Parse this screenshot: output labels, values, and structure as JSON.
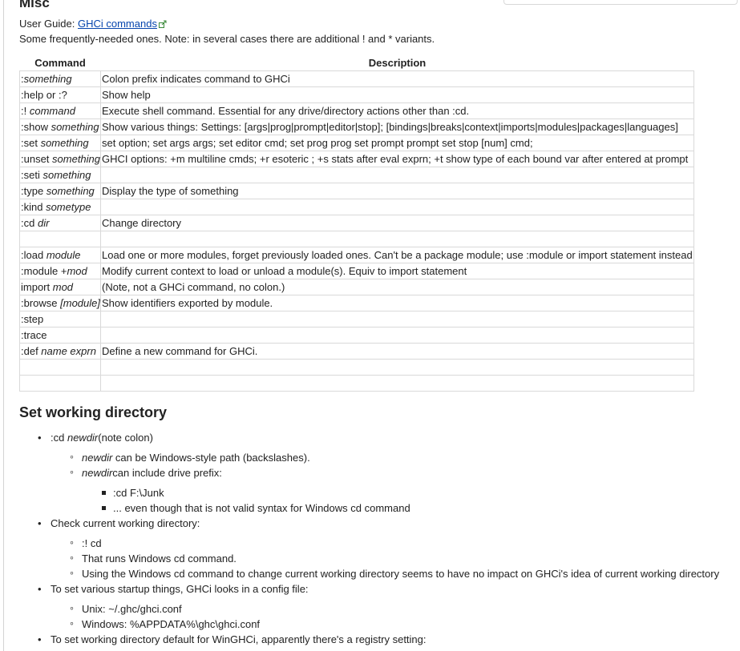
{
  "misc": {
    "heading": "Misc",
    "guide_label": "User Guide: ",
    "guide_link": "GHCi commands",
    "intro": "Some frequently-needed ones. Note: in several cases there are additional ! and * variants."
  },
  "table": {
    "headers": [
      "Command",
      "Description"
    ],
    "rows": [
      {
        "cmd": ":",
        "arg": "something",
        "desc": "Colon prefix indicates command to GHCi"
      },
      {
        "cmd": ":help or :?",
        "arg": "",
        "desc": "Show help"
      },
      {
        "cmd": ":! ",
        "arg": "command",
        "desc": "Execute shell command. Essential for any drive/directory actions other than :cd."
      },
      {
        "cmd": ":show ",
        "arg": "something",
        "desc": "Show various things: Settings: [args|prog|prompt|editor|stop]; [bindings|breaks|context|imports|modules|packages|languages]"
      },
      {
        "cmd": ":set ",
        "arg": "something",
        "desc": "set option; set args args; set editor cmd; set prog prog set prompt prompt set stop [num] cmd;"
      },
      {
        "cmd": ":unset ",
        "arg": "something",
        "desc": "GHCI options: +m multiline cmds; +r esoteric ; +s stats after eval exprn; +t show type of each bound var after entered at prompt"
      },
      {
        "cmd": ":seti ",
        "arg": "something",
        "desc": ""
      },
      {
        "cmd": ":type ",
        "arg": "something",
        "desc": "Display the type of something"
      },
      {
        "cmd": ":kind ",
        "arg": "sometype",
        "desc": ""
      },
      {
        "cmd": ":cd ",
        "arg": "dir",
        "desc": "Change directory"
      },
      {
        "cmd": "",
        "arg": "",
        "desc": ""
      },
      {
        "cmd": ":load ",
        "arg": "module",
        "desc": "Load one or more modules, forget previously loaded ones. Can't be a package module; use :module or import statement instead"
      },
      {
        "cmd": ":module +",
        "arg": "mod",
        "desc": "Modify current context to load or unload a module(s). Equiv to import statement"
      },
      {
        "cmd": "import ",
        "arg": "mod",
        "desc": "(Note, not a GHCi command, no colon.)"
      },
      {
        "cmd": ":browse ",
        "arg": "[module]",
        "desc": "Show identifiers exported by module."
      },
      {
        "cmd": ":step",
        "arg": "",
        "desc": ""
      },
      {
        "cmd": ":trace",
        "arg": "",
        "desc": ""
      },
      {
        "cmd": ":def ",
        "arg": "name exprn",
        "desc": "Define a new command for GHCi."
      },
      {
        "cmd": "",
        "arg": "",
        "desc": ""
      },
      {
        "cmd": "",
        "arg": "",
        "desc": ""
      }
    ]
  },
  "working_dir": {
    "heading": "Set working directory",
    "cd_pre": ":cd ",
    "cd_arg": "newdir",
    "cd_post": "(note colon)",
    "newdir1_arg": "newdir",
    "newdir1_text": " can be Windows-style path (backslashes).",
    "newdir2_arg": "newdir",
    "newdir2_text": "can include drive prefix:",
    "ex1": ":cd F:\\Junk",
    "ex2": "... even though that is not valid syntax for Windows cd command",
    "check": "Check current working directory:",
    "check1": ":! cd",
    "check2": "That runs Windows cd command.",
    "check3": "Using the Windows cd command to change current working directory seems to have no impact on GHCi's idea of current working directory",
    "startup": "To set various startup things, GHCi looks in a config file:",
    "unix": "Unix: ~/.ghc/ghci.conf",
    "windows": "Windows: %APPDATA%\\ghc\\ghci.conf",
    "registry": "To set working directory default for WinGHCi, apparently there's a registry setting:"
  }
}
